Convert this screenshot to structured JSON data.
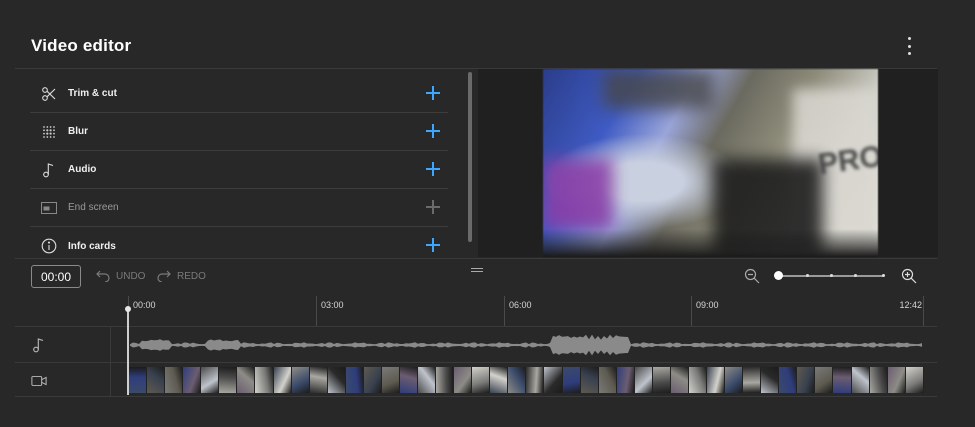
{
  "header": {
    "title": "Video editor",
    "menu_icon": "more-vert-icon"
  },
  "tools": [
    {
      "label": "Trim & cut",
      "icon": "scissors-icon",
      "enabled": true
    },
    {
      "label": "Blur",
      "icon": "blur-grid-icon",
      "enabled": true
    },
    {
      "label": "Audio",
      "icon": "music-note-icon",
      "enabled": true
    },
    {
      "label": "End screen",
      "icon": "end-screen-icon",
      "enabled": false
    },
    {
      "label": "Info cards",
      "icon": "info-icon",
      "enabled": true
    }
  ],
  "controls": {
    "current_time": "00:00",
    "undo_label": "UNDO",
    "redo_label": "REDO"
  },
  "zoom": {
    "level": 0.0,
    "icons": [
      "zoom-out-icon",
      "zoom-in-icon"
    ]
  },
  "timeline": {
    "ticks": [
      "00:00",
      "03:00",
      "06:00",
      "09:00",
      "12:42"
    ],
    "playhead_time": "00:00",
    "tracks": [
      {
        "type": "audio",
        "icon": "music-note-icon"
      },
      {
        "type": "video",
        "icon": "video-camera-icon"
      }
    ]
  },
  "colors": {
    "accent": "#3ea6ff",
    "background": "#282828",
    "preview_bg": "#202020"
  }
}
